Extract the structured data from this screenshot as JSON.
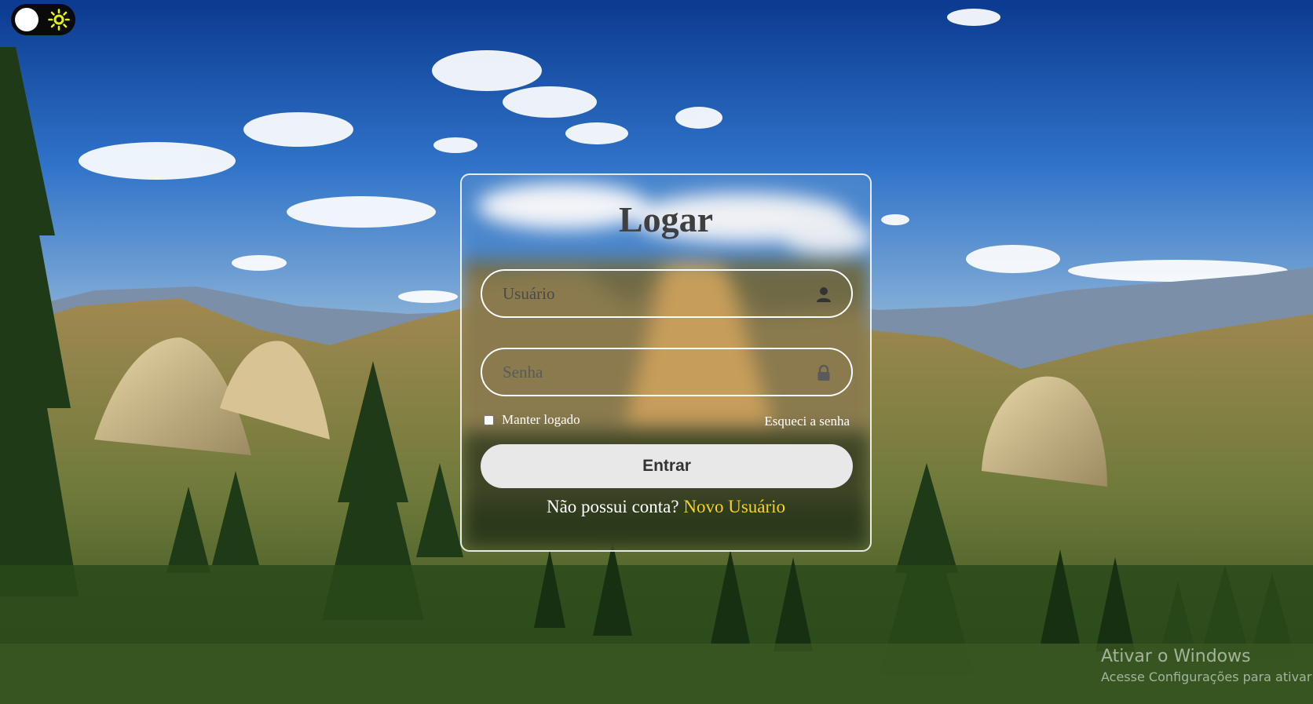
{
  "theme_toggle": {
    "icon": "sun-icon",
    "state": "light",
    "sun_color": "#e6f20a"
  },
  "login": {
    "title": "Logar",
    "username": {
      "placeholder": "Usuário",
      "value": "",
      "icon": "user-icon"
    },
    "password": {
      "placeholder": "Senha",
      "value": "",
      "icon": "lock-icon"
    },
    "remember_label": "Manter logado",
    "remember_checked": false,
    "forgot_label": "Esqueci a senha",
    "submit_label": "Entrar",
    "no_account_text": "Não possui conta?",
    "register_link": "Novo Usuário",
    "link_color": "#f7d31c"
  },
  "watermark": {
    "title": "Ativar o Windows",
    "subtitle": "Acesse Configurações para ativar o"
  }
}
